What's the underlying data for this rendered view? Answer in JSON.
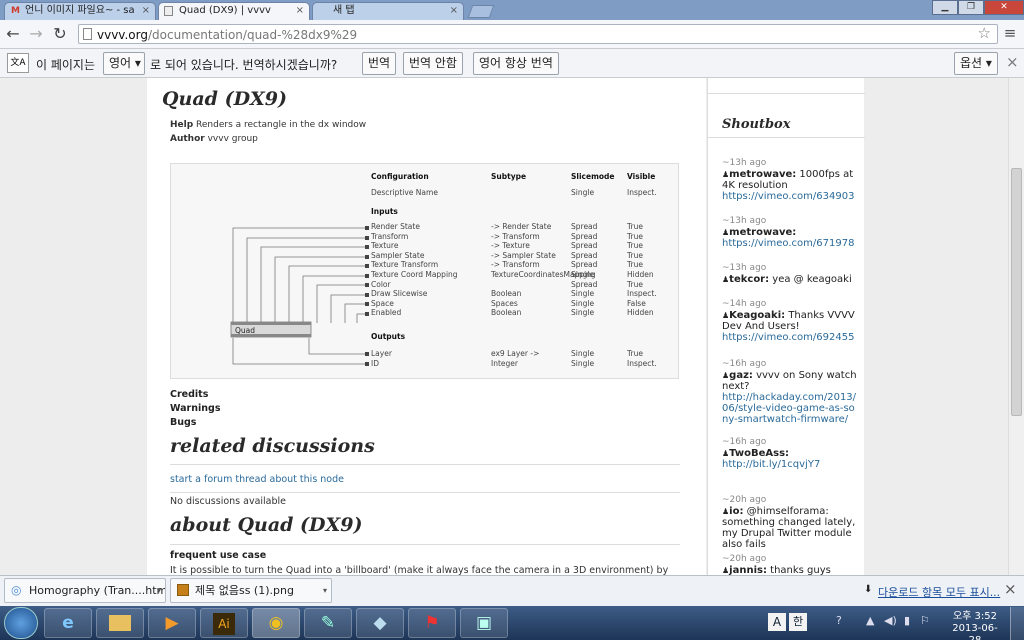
{
  "browser": {
    "tabs": [
      {
        "label": "언니 이미지 파일요~ - sa",
        "icon": "gmail-icon"
      },
      {
        "label": "Quad (DX9) | vvvv",
        "icon": "page-icon"
      },
      {
        "label": "새 탭",
        "icon": ""
      }
    ],
    "close_glyph": "×",
    "new_tab_glyph": "",
    "window_buttons": {
      "minimize": "▁",
      "maximize": "❐",
      "close": "✕"
    },
    "nav": {
      "back": "←",
      "forward": "→",
      "reload": "↻",
      "star": "☆",
      "menu": "≡"
    },
    "url_host": "vvvv.org",
    "url_path": "/documentation/quad-%28dx9%29"
  },
  "translate": {
    "icon_label": "文A",
    "prefix": "이 페이지는",
    "language": "영어",
    "suffix": "로 되어 있습니다. 번역하시겠습니까?",
    "translate_button": "번역",
    "no_translate_button": "번역 안함",
    "always_button": "영어 항상 번역",
    "options_button": "옵션",
    "close": "×"
  },
  "page": {
    "title": "Quad (DX9)",
    "help_label": "Help",
    "help_text": "Renders a rectangle in the dx window",
    "author_label": "Author",
    "author_text": "vvvv group",
    "node_label": "Quad",
    "diagram": {
      "headers": [
        "Configuration",
        "Subtype",
        "Slicemode",
        "Visible"
      ],
      "descriptive": [
        "Descriptive Name",
        "",
        "Single",
        "Inspect."
      ],
      "inputs_label": "Inputs",
      "inputs": [
        [
          "Render State",
          "-> Render State",
          "Spread",
          "True"
        ],
        [
          "Transform",
          "-> Transform",
          "Spread",
          "True"
        ],
        [
          "Texture",
          "-> Texture",
          "Spread",
          "True"
        ],
        [
          "Sampler State",
          "-> Sampler State",
          "Spread",
          "True"
        ],
        [
          "Texture Transform",
          "-> Transform",
          "Spread",
          "True"
        ],
        [
          "Texture Coord Mapping",
          "TextureCoordinatesMapping",
          "Single",
          "Hidden"
        ],
        [
          "Color",
          "",
          "Spread",
          "True"
        ],
        [
          "Draw Slicewise",
          "Boolean",
          "Single",
          "Inspect."
        ],
        [
          "Space",
          "Spaces",
          "Single",
          "False"
        ],
        [
          "Enabled",
          "Boolean",
          "Single",
          "Hidden"
        ]
      ],
      "outputs_label": "Outputs",
      "outputs": [
        [
          "Layer",
          "ex9 Layer ->",
          "Single",
          "True"
        ],
        [
          "ID",
          "Integer",
          "Single",
          "Inspect."
        ]
      ]
    },
    "credits": "Credits",
    "warnings": "Warnings",
    "bugs": "Bugs",
    "related_title": "related discussions",
    "forum_link": "start a forum thread about this node",
    "no_discussions": "No discussions available",
    "about_title": "about Quad (DX9)",
    "frequent_use": "frequent use case",
    "frequent_text": "It is possible to turn the Quad into a 'billboard' (make it always face the camera in a 3D environment) by"
  },
  "sidebar": {
    "title": "Shoutbox",
    "items": [
      {
        "ago": "~13h ago",
        "name": "metrowave:",
        "text": " 1000fps at 4K resolution",
        "link": "https://vimeo.com/6349037"
      },
      {
        "ago": "~13h ago",
        "name": "metrowave:",
        "text": "",
        "link": "https://vimeo.com/6719782"
      },
      {
        "ago": "~13h ago",
        "name": "tekcor:",
        "text": " yea @ keagoaki",
        "link": ""
      },
      {
        "ago": "~14h ago",
        "name": "Keagoaki:",
        "text": " Thanks VVVV Dev And Users!",
        "link": "https://vimeo.com/6924550"
      },
      {
        "ago": "~16h ago",
        "name": "gaz:",
        "text": " vvvv on Sony watch next?",
        "link": "http://hackaday.com/2013/06/style-video-game-as-sony-smartwatch-firmware/"
      },
      {
        "ago": "~16h ago",
        "name": "TwoBeAss:",
        "text": "",
        "link": "http://bit.ly/1cqvjY7"
      },
      {
        "ago": "~20h ago",
        "name": "io:",
        "text": " @himselforama: something changed lately, my Drupal Twitter module also fails",
        "link": ""
      },
      {
        "ago": "~20h ago",
        "name": "jannis:",
        "text": " thanks guys",
        "link": ""
      }
    ]
  },
  "downloads": {
    "items": [
      {
        "label": "Homography (Tran....htm"
      },
      {
        "label": "제목 없음ss (1).png"
      }
    ],
    "show_all": "다운로드 항목 모두 표시...",
    "close": "×"
  },
  "taskbar": {
    "clock_time": "오후 3:52",
    "clock_date": "2013-06-28",
    "tray_ime": "A",
    "tray_mode": "한"
  },
  "colors": {
    "link": "#2a6a9a",
    "accent": "#3d5c86"
  }
}
